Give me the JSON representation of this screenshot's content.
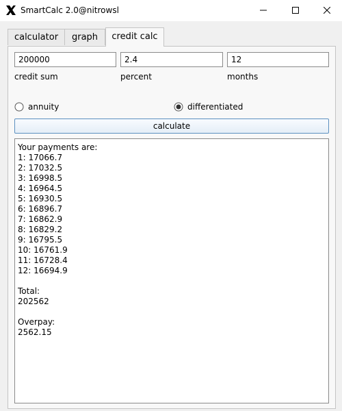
{
  "window": {
    "title": "SmartCalc 2.0@nitrowsl",
    "logo_icon": "x-logo-icon",
    "controls": {
      "minimize_icon": "minimize-icon",
      "maximize_icon": "maximize-icon",
      "close_icon": "close-icon"
    }
  },
  "tabs": [
    {
      "label": "calculator"
    },
    {
      "label": "graph"
    },
    {
      "label": "credit calc",
      "active": true
    }
  ],
  "form": {
    "credit_sum": {
      "value": "200000",
      "label": "credit sum"
    },
    "percent": {
      "value": "2.4",
      "label": "percent"
    },
    "months": {
      "value": "12",
      "label": "months"
    }
  },
  "payment_type": {
    "annuity": {
      "label": "annuity",
      "checked": false
    },
    "differentiated": {
      "label": "differentiated",
      "checked": true
    }
  },
  "calculate_label": "calculate",
  "result": {
    "header": "Your payments are:",
    "payments": [
      "1: 17066.7",
      "2: 17032.5",
      "3: 16998.5",
      "4: 16964.5",
      "5: 16930.5",
      "6: 16896.7",
      "7: 16862.9",
      "8: 16829.2",
      "9: 16795.5",
      "10: 16761.9",
      "11: 16728.4",
      "12: 16694.9"
    ],
    "total_label": "Total:",
    "total_value": "202562",
    "overpay_label": "Overpay:",
    "overpay_value": "2562.15"
  },
  "colors": {
    "accent_border": "#5b8fbf",
    "window_bg": "#f0f0f0"
  }
}
